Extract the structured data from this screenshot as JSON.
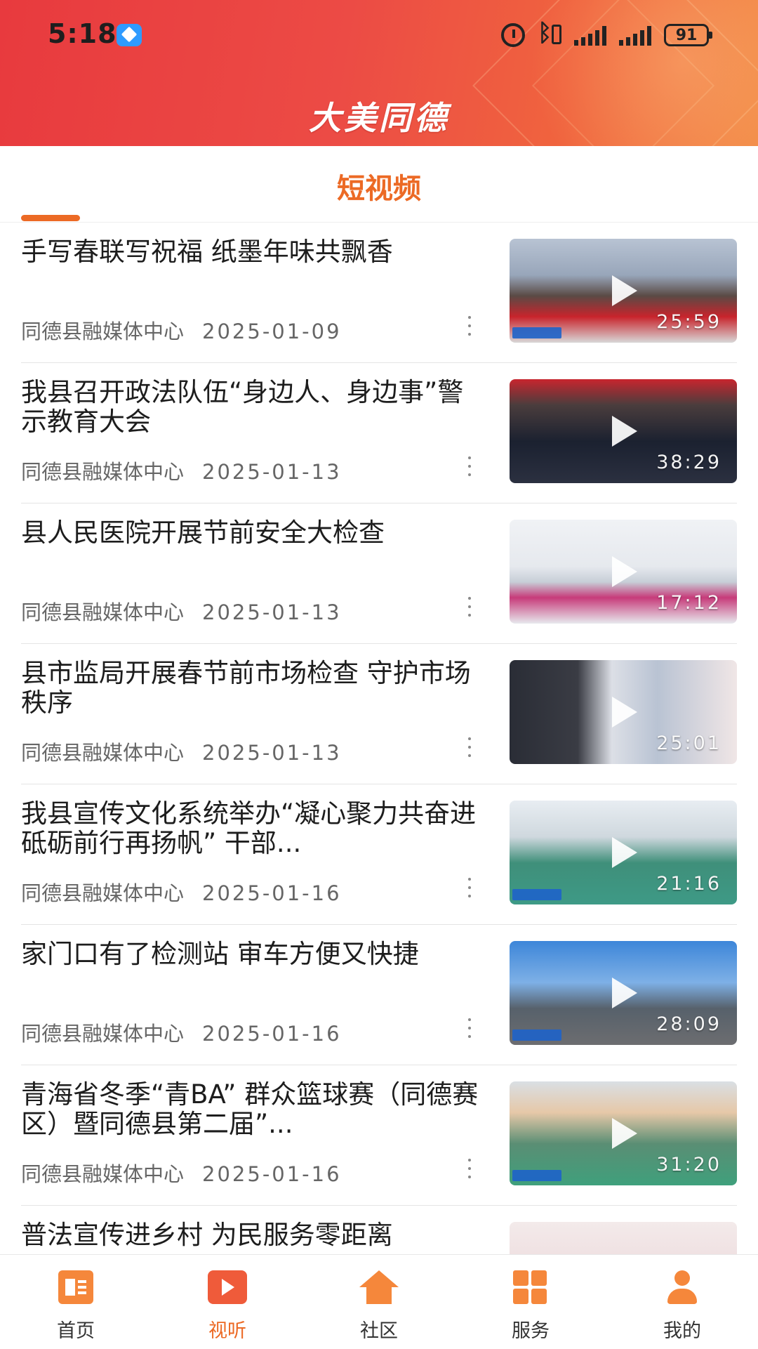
{
  "status_bar": {
    "time": "5:18",
    "battery": "91",
    "icons": [
      "app-notification-icon",
      "alarm-icon",
      "bluetooth-icon",
      "vibrate-icon",
      "signal-icon",
      "signal-icon",
      "battery-icon"
    ]
  },
  "header": {
    "app_title": "大美同德"
  },
  "section": {
    "title": "短视频"
  },
  "news": [
    {
      "title": "手写春联写祝福  纸墨年味共飘香",
      "source": "同德县融媒体中心",
      "date": "2025-01-09",
      "duration": "25:59"
    },
    {
      "title": "我县召开政法队伍“身边人、身边事”警示教育大会",
      "source": "同德县融媒体中心",
      "date": "2025-01-13",
      "duration": "38:29"
    },
    {
      "title": "县人民医院开展节前安全大检查",
      "source": "同德县融媒体中心",
      "date": "2025-01-13",
      "duration": "17:12"
    },
    {
      "title": "县市监局开展春节前市场检查  守护市场秩序",
      "source": "同德县融媒体中心",
      "date": "2025-01-13",
      "duration": "25:01"
    },
    {
      "title": "我县宣传文化系统举办“凝心聚力共奋进  砥砺前行再扬帆”  干部...",
      "source": "同德县融媒体中心",
      "date": "2025-01-16",
      "duration": "21:16"
    },
    {
      "title": "家门口有了检测站  审车方便又快捷",
      "source": "同德县融媒体中心",
      "date": "2025-01-16",
      "duration": "28:09"
    },
    {
      "title": "青海省冬季“青BA”  群众篮球赛（同德赛区）暨同德县第二届”...",
      "source": "同德县融媒体中心",
      "date": "2025-01-16",
      "duration": "31:20"
    },
    {
      "title": "普法宣传进乡村  为民服务零距离",
      "source": "",
      "date": "",
      "duration": ""
    }
  ],
  "bottom_nav": [
    {
      "label": "首页",
      "icon": "home-icon"
    },
    {
      "label": "视听",
      "icon": "video-icon",
      "active": true
    },
    {
      "label": "社区",
      "icon": "community-icon"
    },
    {
      "label": "服务",
      "icon": "service-grid-icon"
    },
    {
      "label": "我的",
      "icon": "profile-icon"
    }
  ],
  "colors": {
    "accent": "#ec6a25",
    "header_start": "#e83a3e",
    "header_end": "#f28a45"
  }
}
